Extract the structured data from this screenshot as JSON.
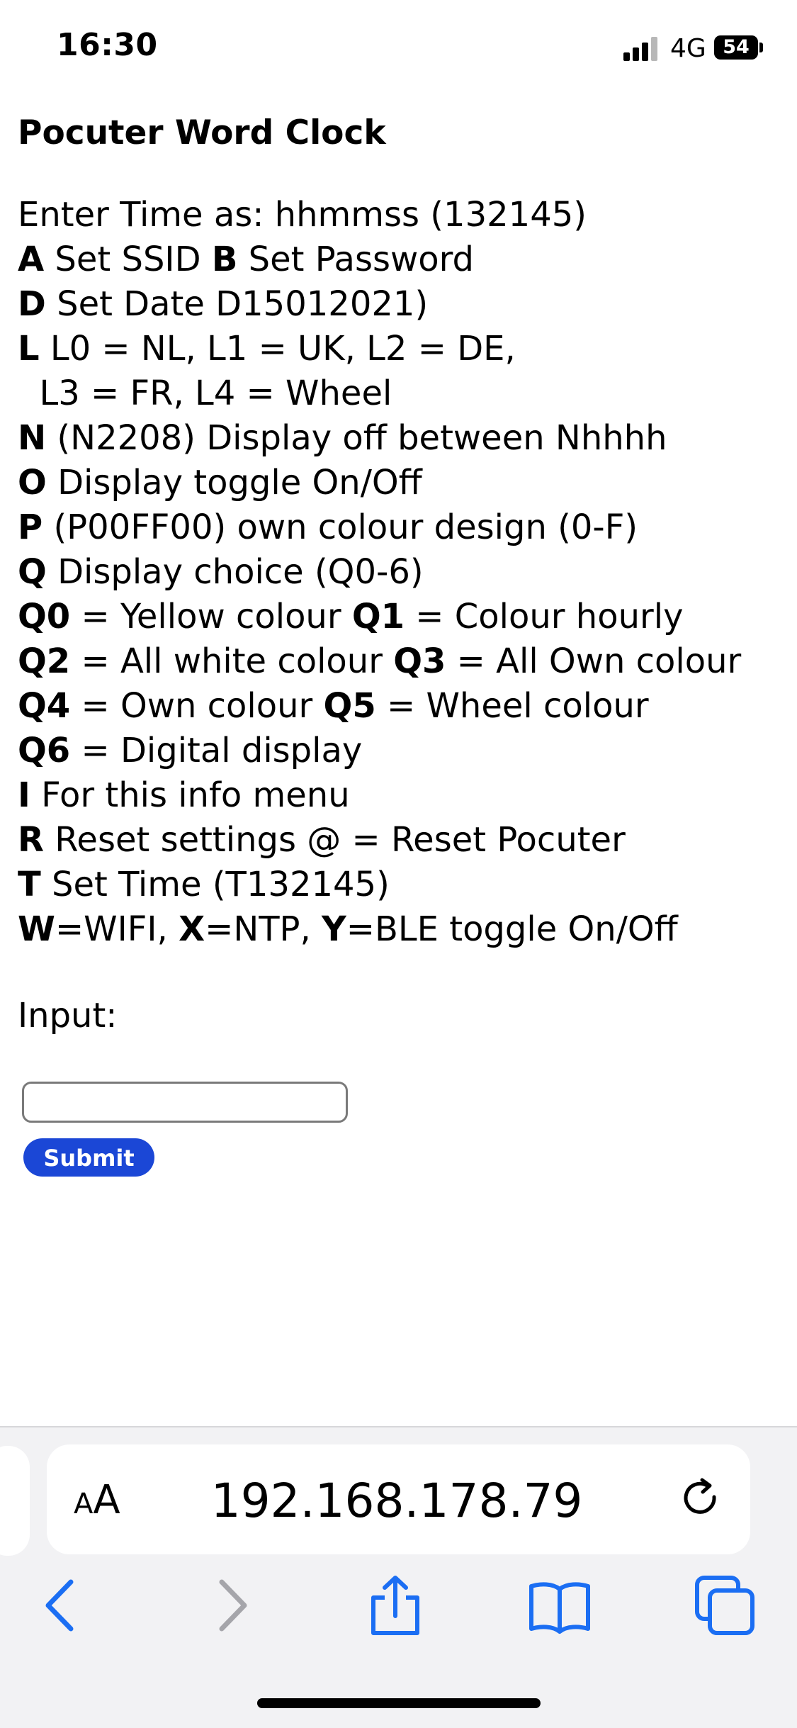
{
  "status": {
    "time": "16:30",
    "network": "4G",
    "battery": "54"
  },
  "page": {
    "title": "Pocuter Word Clock",
    "lines": [
      [
        {
          "t": "Enter Time as: hhmmss (132145)"
        }
      ],
      [
        {
          "t": "A",
          "b": true
        },
        {
          "t": " Set SSID "
        },
        {
          "t": "B",
          "b": true
        },
        {
          "t": " Set Password"
        }
      ],
      [
        {
          "t": "D",
          "b": true
        },
        {
          "t": " Set Date D15012021)"
        }
      ],
      [
        {
          "t": "L",
          "b": true
        },
        {
          "t": " L0 = NL, L1 = UK, L2 = DE,"
        }
      ],
      [
        {
          "t": "  L3 = FR, L4 = Wheel"
        }
      ],
      [
        {
          "t": "N",
          "b": true
        },
        {
          "t": " (N2208) Display off between Nhhhh"
        }
      ],
      [
        {
          "t": "O",
          "b": true
        },
        {
          "t": " Display toggle On/Off"
        }
      ],
      [
        {
          "t": "P",
          "b": true
        },
        {
          "t": " (P00FF00) own colour design (0-F)"
        }
      ],
      [
        {
          "t": "Q",
          "b": true
        },
        {
          "t": " Display choice (Q0-6)"
        }
      ],
      [
        {
          "t": "Q0",
          "b": true
        },
        {
          "t": " = Yellow colour "
        },
        {
          "t": "Q1",
          "b": true
        },
        {
          "t": " = Colour hourly"
        }
      ],
      [
        {
          "t": "Q2",
          "b": true
        },
        {
          "t": " = All white colour "
        },
        {
          "t": "Q3",
          "b": true
        },
        {
          "t": " = All Own colour"
        }
      ],
      [
        {
          "t": "Q4",
          "b": true
        },
        {
          "t": " = Own colour "
        },
        {
          "t": "Q5",
          "b": true
        },
        {
          "t": " = Wheel colour"
        }
      ],
      [
        {
          "t": "Q6",
          "b": true
        },
        {
          "t": " = Digital display"
        }
      ],
      [
        {
          "t": "I",
          "b": true
        },
        {
          "t": " For this info menu"
        }
      ],
      [
        {
          "t": "R",
          "b": true
        },
        {
          "t": " Reset settings @ = Reset Pocuter"
        }
      ],
      [
        {
          "t": "T",
          "b": true
        },
        {
          "t": " Set Time (T132145)"
        }
      ],
      [
        {
          "t": "W",
          "b": true
        },
        {
          "t": "=WIFI, "
        },
        {
          "t": "X",
          "b": true
        },
        {
          "t": "=NTP, "
        },
        {
          "t": "Y",
          "b": true
        },
        {
          "t": "=BLE toggle On/Off"
        }
      ]
    ],
    "input_label": "Input:",
    "input_value": "",
    "submit_label": "Submit",
    "submit_color": "#1b47d6"
  },
  "browser": {
    "aa_large": "A",
    "aa_small": "A",
    "url": "192.168.178.79",
    "accent": "#1b6ef3",
    "icons": [
      "back-icon",
      "forward-icon",
      "share-icon",
      "bookmarks-icon",
      "tabs-icon"
    ]
  }
}
